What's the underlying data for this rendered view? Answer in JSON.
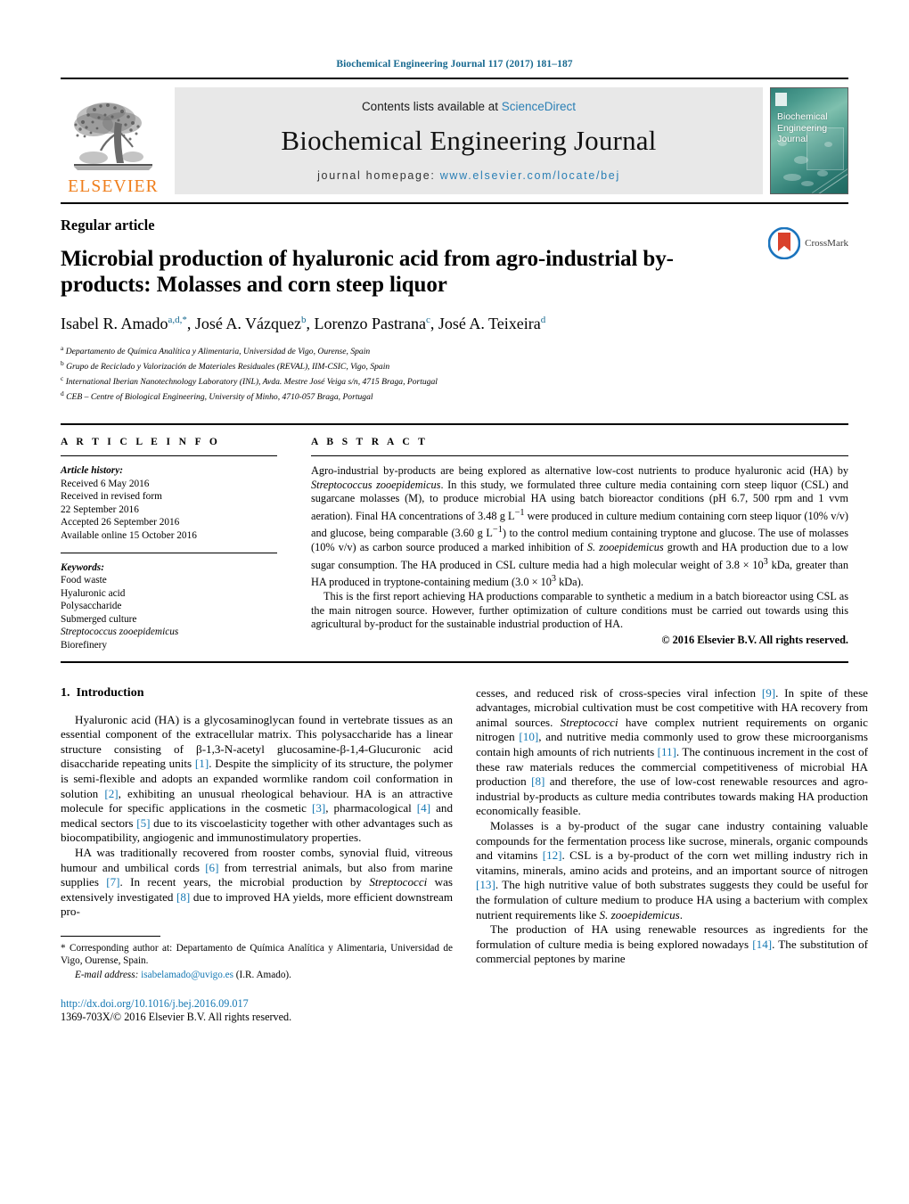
{
  "running_head": "Biochemical Engineering Journal 117 (2017) 181–187",
  "masthead": {
    "contents_prefix": "Contents lists available at ",
    "sciencedirect": "ScienceDirect",
    "journal_title": "Biochemical Engineering Journal",
    "homepage_prefix": "journal homepage: ",
    "homepage_url": "www.elsevier.com/locate/bej",
    "publisher": "ELSEVIER",
    "cover_title_line1": "Biochemical",
    "cover_title_line2": "Engineering",
    "cover_title_line3": "Journal",
    "accent_link_color": "#2a7fb5",
    "running_head_color": "#16688f",
    "elsevier_orange": "#ef7d1a"
  },
  "article": {
    "type_label": "Regular article",
    "title": "Microbial production of hyaluronic acid from agro-industrial by-products: Molasses and corn steep liquor",
    "crossmark_label": "CrossMark",
    "authors": [
      {
        "name": "Isabel R. Amado",
        "sup": "a,d,*"
      },
      {
        "name": "José A. Vázquez",
        "sup": "b"
      },
      {
        "name": "Lorenzo Pastrana",
        "sup": "c"
      },
      {
        "name": "José A. Teixeira",
        "sup": "d"
      }
    ],
    "affiliations": [
      {
        "mark": "a",
        "text": "Departamento de Química Analítica y Alimentaria, Universidad de Vigo, Ourense, Spain"
      },
      {
        "mark": "b",
        "text": "Grupo de Reciclado y Valorización de Materiales Residuales (REVAL), IIM-CSIC, Vigo, Spain"
      },
      {
        "mark": "c",
        "text": "International Iberian Nanotechnology Laboratory (INL), Avda. Mestre José Veiga s/n, 4715 Braga, Portugal"
      },
      {
        "mark": "d",
        "text": "CEB – Centre of Biological Engineering, University of Minho, 4710-057 Braga, Portugal"
      }
    ]
  },
  "article_info": {
    "heading": "A R T I C L E   I N F O",
    "history_label": "Article history:",
    "history": [
      "Received 6 May 2016",
      "Received in revised form",
      "22 September 2016",
      "Accepted 26 September 2016",
      "Available online 15 October 2016"
    ],
    "keywords_label": "Keywords:",
    "keywords": [
      "Food waste",
      "Hyaluronic acid",
      "Polysaccharide",
      "Submerged culture",
      "Streptococcus zooepidemicus",
      "Biorefinery"
    ],
    "keyword_italic_index": 4
  },
  "abstract": {
    "heading": "A B S T R A C T",
    "paragraph1": "Agro-industrial by-products are being explored as alternative low-cost nutrients to produce hyaluronic acid (HA) by Streptococcus zooepidemicus. In this study, we formulated three culture media containing corn steep liquor (CSL) and sugarcane molasses (M), to produce microbial HA using batch bioreactor conditions (pH 6.7, 500 rpm and 1 vvm aeration). Final HA concentrations of 3.48 g L−1 were produced in culture medium containing corn steep liquor (10% v/v) and glucose, being comparable (3.60 g L−1) to the control medium containing tryptone and glucose. The use of molasses (10% v/v) as carbon source produced a marked inhibition of S. zooepidemicus growth and HA production due to a low sugar consumption. The HA produced in CSL culture media had a high molecular weight of 3.8 × 103 kDa, greater than HA produced in tryptone-containing medium (3.0 × 103 kDa).",
    "paragraph2": "This is the first report achieving HA productions comparable to synthetic a medium in a batch bioreactor using CSL as the main nitrogen source. However, further optimization of culture conditions must be carried out towards using this agricultural by-product for the sustainable industrial production of HA.",
    "copyright": "© 2016 Elsevier B.V. All rights reserved."
  },
  "introduction": {
    "section_number": "1.",
    "section_title": "Introduction",
    "left_paragraphs": [
      "Hyaluronic acid (HA) is a glycosaminoglycan found in vertebrate tissues as an essential component of the extracellular matrix. This polysaccharide has a linear structure consisting of β-1,3-N-acetyl glucosamine-β-1,4-Glucuronic acid disaccharide repeating units [1]. Despite the simplicity of its structure, the polymer is semi-flexible and adopts an expanded wormlike random coil conformation in solution [2], exhibiting an unusual rheological behaviour. HA is an attractive molecule for specific applications in the cosmetic [3], pharmacological [4] and medical sectors [5] due to its viscoelasticity together with other advantages such as biocompatibility, angiogenic and immunostimulatory properties.",
      "HA was traditionally recovered from rooster combs, synovial fluid, vitreous humour and umbilical cords [6] from terrestrial animals, but also from marine supplies [7]. In recent years, the microbial production by Streptococci was extensively investigated [8] due to improved HA yields, more efficient downstream pro-"
    ],
    "right_paragraphs": [
      "cesses, and reduced risk of cross-species viral infection [9]. In spite of these advantages, microbial cultivation must be cost competitive with HA recovery from animal sources. Streptococci have complex nutrient requirements on organic nitrogen [10], and nutritive media commonly used to grow these microorganisms contain high amounts of rich nutrients [11]. The continuous increment in the cost of these raw materials reduces the commercial competitiveness of microbial HA production [8] and therefore, the use of low-cost renewable resources and agro-industrial by-products as culture media contributes towards making HA production economically feasible.",
      "Molasses is a by-product of the sugar cane industry containing valuable compounds for the fermentation process like sucrose, minerals, organic compounds and vitamins [12]. CSL is a by-product of the corn wet milling industry rich in vitamins, minerals, amino acids and proteins, and an important source of nitrogen [13]. The high nutritive value of both substrates suggests they could be useful for the formulation of culture medium to produce HA using a bacterium with complex nutrient requirements like S. zooepidemicus.",
      "The production of HA using renewable resources as ingredients for the formulation of culture media is being explored nowadays [14]. The substitution of commercial peptones by marine"
    ]
  },
  "footnote": {
    "corresponding": "* Corresponding author at: Departamento de Química Analítica y Alimentaria, Universidad de Vigo, Ourense, Spain.",
    "email_label": "E-mail address:",
    "email": "isabelamado@uvigo.es",
    "email_owner": "(I.R. Amado)."
  },
  "footer": {
    "doi": "http://dx.doi.org/10.1016/j.bej.2016.09.017",
    "issn": "1369-703X/© 2016 Elsevier B.V. All rights reserved."
  }
}
